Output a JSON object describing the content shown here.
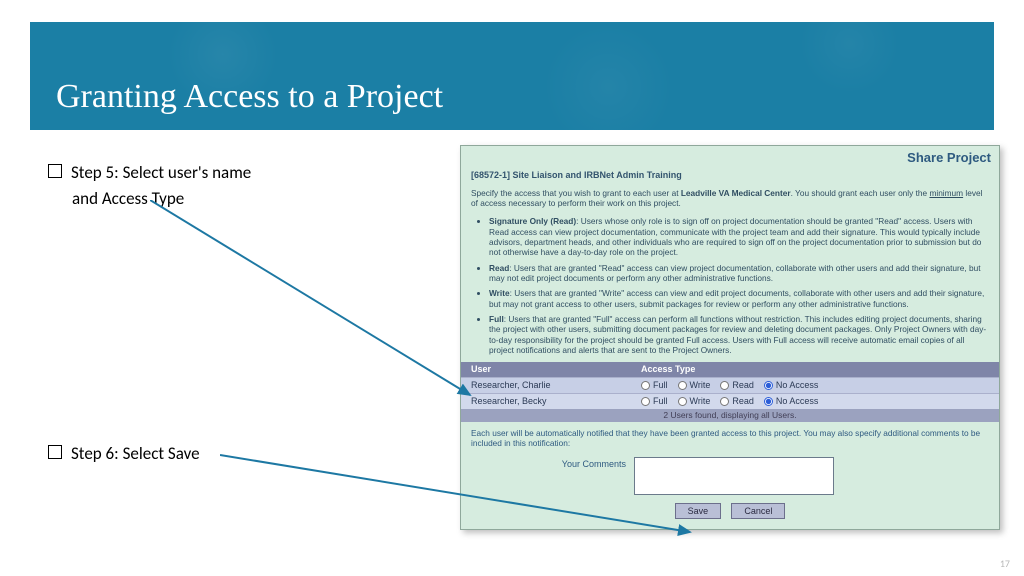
{
  "slide": {
    "title": "Granting Access to a Project",
    "step5_line1": "Step 5: Select user's name",
    "step5_line2": "and Access Type",
    "step6": "Step 6: Select Save",
    "number": "17"
  },
  "panel": {
    "heading": "Share Project",
    "project": "[68572-1] Site Liaison and IRBNet Admin Training",
    "intro_a": "Specify the access that you wish to grant to each user at ",
    "intro_b": "Leadville VA Medical Center",
    "intro_c": ". You should grant each user only the ",
    "intro_u": "minimum",
    "intro_d": " level of access necessary to perform their work on this project.",
    "roles": [
      {
        "label": "Signature Only (Read)",
        "text": ": Users whose only role is to sign off on project documentation should be granted \"Read\" access. Users with Read access can view project documentation, communicate with the project team and add their signature. This would typically include advisors, department heads, and other individuals who are required to sign off on the project documentation prior to submission but do not otherwise have a day-to-day role on the project."
      },
      {
        "label": "Read",
        "text": ": Users that are granted \"Read\" access can view project documentation, collaborate with other users and add their signature, but may not edit project documents or perform any other administrative functions."
      },
      {
        "label": "Write",
        "text": ": Users that are granted \"Write\" access can view and edit project documents, collaborate with other users and add their signature, but may not grant access to other users, submit packages for review or perform any other administrative functions."
      },
      {
        "label": "Full",
        "text": ": Users that are granted \"Full\" access can perform all functions without restriction. This includes editing project documents, sharing the project with other users, submitting document packages for review and deleting document packages. Only Project Owners with day-to-day responsibility for the project should be granted Full access. Users with Full access will receive automatic email copies of all project notifications and alerts that are sent to the Project Owners."
      }
    ],
    "columns": {
      "user": "User",
      "access": "Access Type"
    },
    "options": [
      "Full",
      "Write",
      "Read",
      "No Access"
    ],
    "rows": [
      {
        "name": "Researcher, Charlie",
        "selected": 3
      },
      {
        "name": "Researcher, Becky",
        "selected": 3
      }
    ],
    "footer": "2 Users found, displaying all Users.",
    "note": "Each user will be automatically notified that they have been granted access to this project. You may also specify additional comments to be included in this notification:",
    "comments_label": "Your Comments",
    "save": "Save",
    "cancel": "Cancel"
  }
}
